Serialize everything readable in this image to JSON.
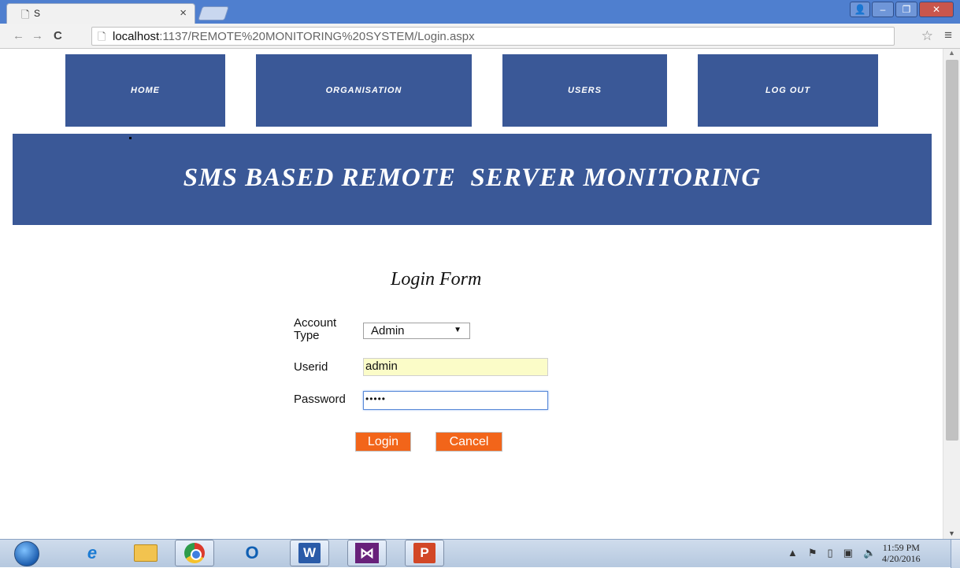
{
  "browser": {
    "tab_title": "S",
    "url_host": "localhost",
    "url_path": ":1137/REMOTE%20MONITORING%20SYSTEM/Login.aspx"
  },
  "nav": {
    "home": "HOME",
    "organisation": "ORGANISATION",
    "users": "USERS",
    "logout": "LOG OUT"
  },
  "banner": {
    "title": "SMS BASED REMOTE  SERVER MONITORING"
  },
  "form": {
    "title": "Login Form",
    "account_type_label": "Account Type",
    "account_type_value": "Admin",
    "userid_label": "Userid",
    "userid_value": "admin",
    "password_label": "Password",
    "password_value": "•••••",
    "login_button": "Login",
    "cancel_button": "Cancel"
  },
  "taskbar": {
    "time": "11:59 PM",
    "date": "4/20/2016"
  },
  "colors": {
    "nav_blue": "#3a5897",
    "button_orange": "#f2651a",
    "userid_bg": "#fbfcc8"
  }
}
